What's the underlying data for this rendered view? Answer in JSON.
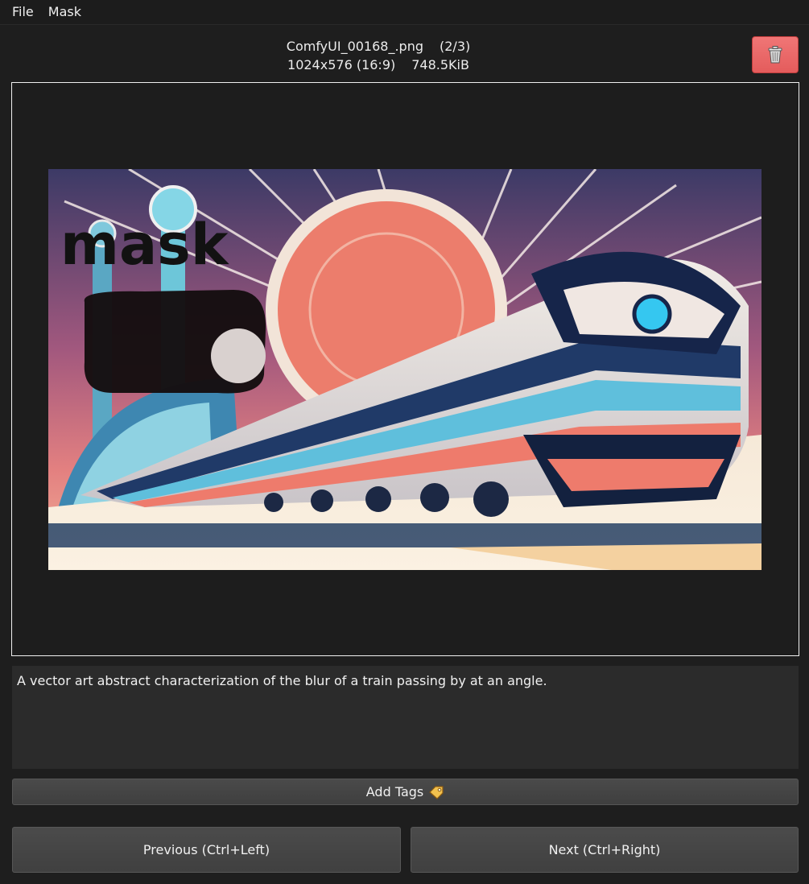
{
  "menubar": {
    "items": [
      "File",
      "Mask"
    ]
  },
  "file": {
    "name": "ComfyUI_00168_.png",
    "position": "(2/3)",
    "dimensions": "1024x576 (16:9)",
    "size": "748.5KiB"
  },
  "delete_button": {
    "icon": "trash-icon",
    "color": "#e95f5f"
  },
  "image": {
    "mask_text": "mask"
  },
  "caption": {
    "text": "A vector art abstract characterization of the blur of a train passing by at an angle."
  },
  "add_tags": {
    "label": "Add Tags",
    "icon": "tag-icon"
  },
  "nav": {
    "previous_label": "Previous (Ctrl+Left)",
    "next_label": "Next (Ctrl+Right)"
  }
}
